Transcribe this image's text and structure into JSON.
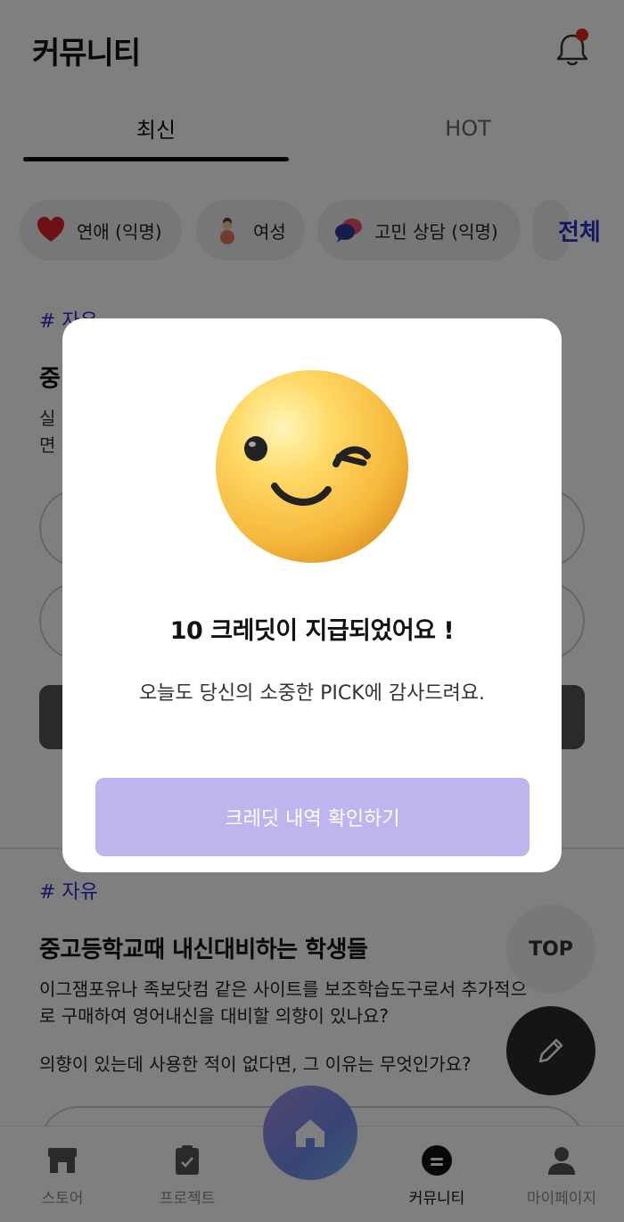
{
  "header": {
    "title": "커뮤니티",
    "bell_icon": "bell-icon",
    "notification_dot_color": "#e0261a"
  },
  "tabs": [
    {
      "label": "최신",
      "active": true
    },
    {
      "label": "HOT",
      "active": false
    }
  ],
  "categories": {
    "chips": [
      {
        "label": "연애 (익명)",
        "icon": "heart-icon"
      },
      {
        "label": "여성",
        "icon": "doll-icon"
      },
      {
        "label": "고민 상담 (익명)",
        "icon": "speech-bubbles-icon"
      }
    ],
    "all_label": "전체"
  },
  "post1": {
    "tag": "# 자유",
    "title_partial": "중",
    "body_partial_1": "실",
    "body_partial_2": "면"
  },
  "post2": {
    "tag": "# 자유",
    "title": "중고등학교때 내신대비하는 학생들",
    "body_line1": "이그잼포유나 족보닷컴 같은 사이트를 보조학습도구로서 추가적으로 구매하여 영어내신을 대비할 의향이 있나요?",
    "body_line2": "의향이 있는데 사용한 적이 없다면, 그 이유는 무엇인가요?"
  },
  "floating": {
    "top_label": "TOP",
    "write_icon": "pencil-icon"
  },
  "bottom_nav": [
    {
      "label": "스토어",
      "icon": "store-icon"
    },
    {
      "label": "프로젝트",
      "icon": "clipboard-icon"
    },
    {
      "label": "커뮤니티",
      "icon": "chat-icon",
      "active": true
    },
    {
      "label": "마이페이지",
      "icon": "person-icon"
    }
  ],
  "modal": {
    "emoji_icon": "winking-face-icon",
    "title": "10 크레딧이 지급되었어요 !",
    "message": "오늘도 당신의 소중한 PICK에 감사드려요.",
    "button_label": "크레딧 내역 확인하기",
    "button_color": "#bfb4ee"
  },
  "colors": {
    "accent": "#2c2fc9",
    "overlay": "rgba(0,0,0,0.5)"
  }
}
